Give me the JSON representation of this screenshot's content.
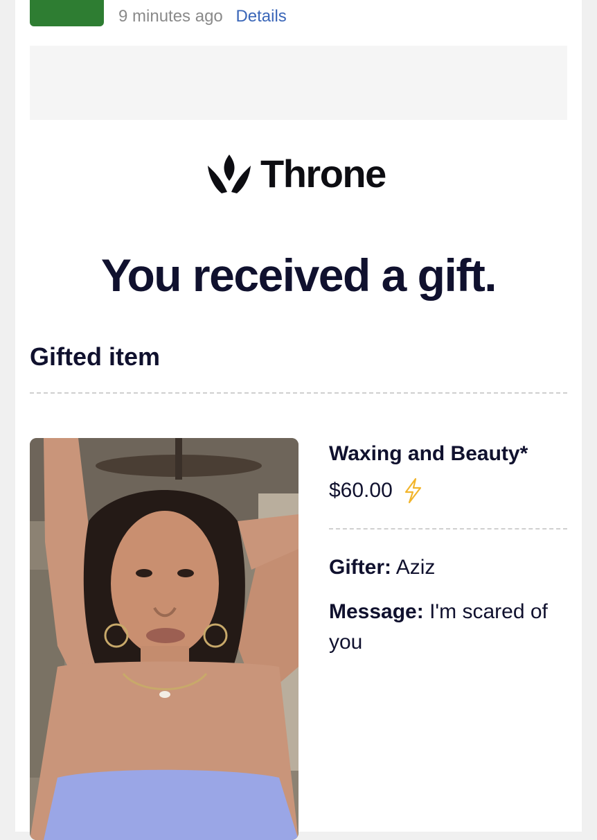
{
  "email_header": {
    "timestamp": "9 minutes ago",
    "details_link": "Details"
  },
  "brand": {
    "name": "Throne",
    "logo_icon": "crown-leaf-icon"
  },
  "headline": "You received a gift.",
  "section": {
    "title": "Gifted item"
  },
  "item": {
    "name": "Waxing and Beauty*",
    "price": "$60.00",
    "price_icon": "lightning-bolt-icon",
    "gifter_label": "Gifter:",
    "gifter_value": "Aziz",
    "message_label": "Message:",
    "message_value": "I'm scared of you"
  },
  "colors": {
    "text_dark": "#10112e",
    "link": "#3a66b8",
    "avatar_green": "#2e7d32",
    "bolt": "#f2b52c"
  }
}
